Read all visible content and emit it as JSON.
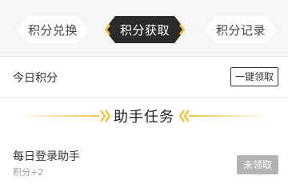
{
  "tabs": [
    {
      "label": "积分兑换",
      "active": false
    },
    {
      "label": "积分获取",
      "active": true
    },
    {
      "label": "积分记录",
      "active": false
    }
  ],
  "today": {
    "label": "今日积分",
    "claim_all_label": "一键领取"
  },
  "section": {
    "title": "助手任务"
  },
  "tasks": [
    {
      "title": "每日登录助手",
      "reward": "积分+2",
      "button_label": "未领取"
    }
  ],
  "colors": {
    "accent": "#f0c23c",
    "active_tab_bg": "#2b2b2b",
    "button_disabled": "#b3b3b3"
  },
  "icons": {
    "section_left": "double-chevron-right-icon",
    "section_right": "double-chevron-left-icon"
  }
}
